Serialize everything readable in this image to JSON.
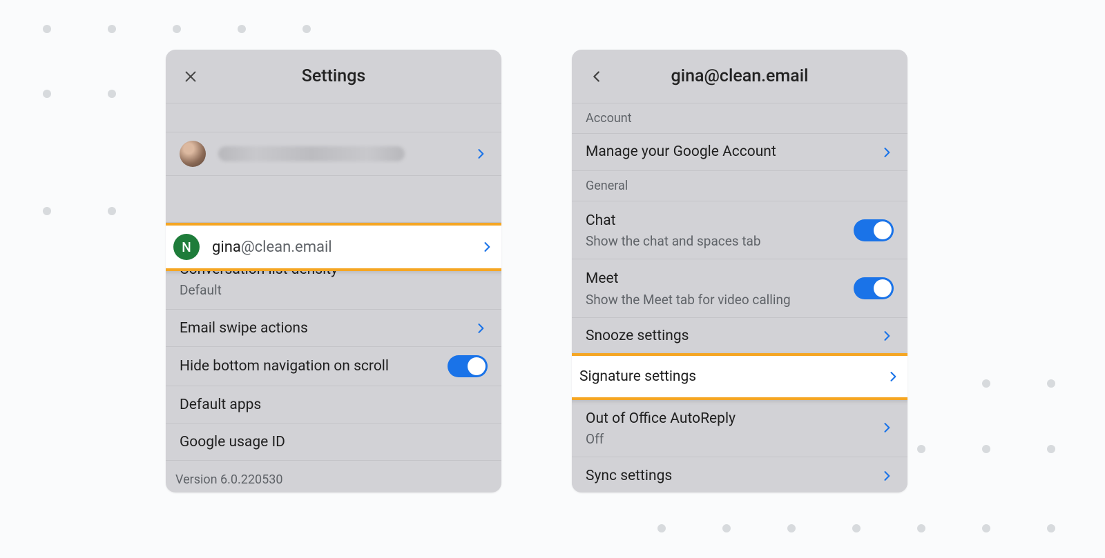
{
  "panel1": {
    "title": "Settings",
    "accounts": [
      {
        "avatar_letter": "",
        "email_local": "",
        "email_domain": "",
        "blurred": true
      },
      {
        "avatar_letter": "N",
        "email_local": "gina",
        "email_domain": "@clean.email",
        "blurred": false
      }
    ],
    "density": {
      "title": "Conversation list density",
      "value": "Default"
    },
    "swipe": {
      "title": "Email swipe actions"
    },
    "hide_nav": {
      "title": "Hide bottom navigation on scroll",
      "on": true
    },
    "default_apps": {
      "title": "Default apps"
    },
    "google_usage": {
      "title": "Google usage ID"
    },
    "version": "Version 6.0.220530"
  },
  "panel2": {
    "title": "gina@clean.email",
    "sections": {
      "account": "Account",
      "general": "General"
    },
    "manage": "Manage your Google Account",
    "chat": {
      "title": "Chat",
      "subtitle": "Show the chat and spaces tab",
      "on": true
    },
    "meet": {
      "title": "Meet",
      "subtitle": "Show the Meet tab for video calling",
      "on": true
    },
    "snooze": "Snooze settings",
    "signature": "Signature settings",
    "ooo": {
      "title": "Out of Office AutoReply",
      "value": "Off"
    },
    "sync": "Sync settings"
  }
}
